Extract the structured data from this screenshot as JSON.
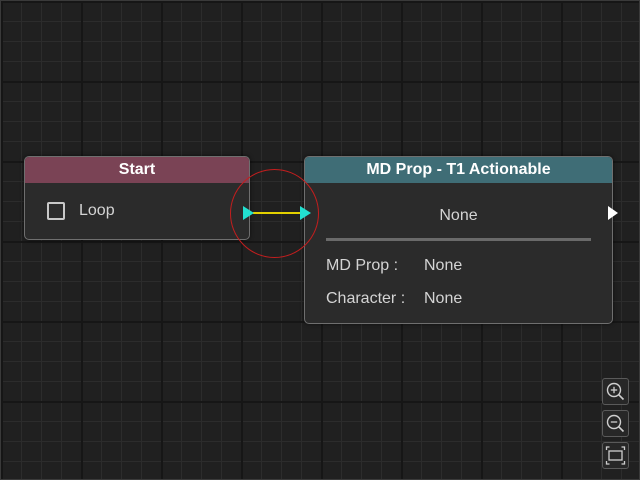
{
  "start_node": {
    "title": "Start",
    "header_color": "#7a4355",
    "loop": {
      "label": "Loop",
      "checked": false
    }
  },
  "md_prop_node": {
    "title": "MD Prop - T1 Actionable",
    "header_color": "#3f6d76",
    "value": "None",
    "fields": [
      {
        "label": "MD Prop :",
        "value": "None"
      },
      {
        "label": "Character :",
        "value": "None"
      }
    ]
  },
  "connection": {
    "color": "#e2d000",
    "port_color": "#22e0d0",
    "highlight_color": "#c41e1e"
  },
  "zoom_controls": {
    "icons": [
      "zoom-in-icon",
      "zoom-out-icon",
      "fit-view-icon"
    ]
  }
}
